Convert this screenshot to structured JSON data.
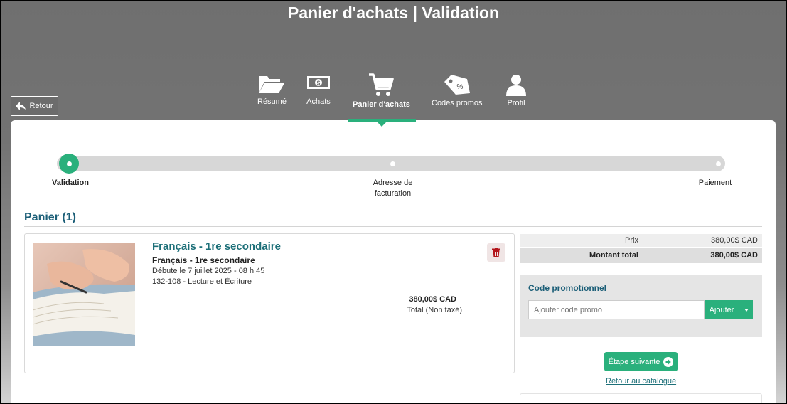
{
  "header": {
    "title": "Panier d'achats | Validation"
  },
  "back_button": {
    "label": "Retour"
  },
  "nav": {
    "items": [
      {
        "label": "Résumé",
        "icon": "folder-open-icon"
      },
      {
        "label": "Achats",
        "icon": "money-bill-icon"
      },
      {
        "label": "Panier d'achats",
        "icon": "shopping-cart-icon",
        "active": true
      },
      {
        "label": "Codes promos",
        "icon": "tag-percent-icon"
      },
      {
        "label": "Profil",
        "icon": "user-icon"
      }
    ]
  },
  "steps": [
    {
      "label": "Validation",
      "active": true
    },
    {
      "label_line1": "Adresse de",
      "label_line2": "facturation"
    },
    {
      "label": "Paiement"
    }
  ],
  "cart": {
    "heading": "Panier (1)",
    "item": {
      "title": "Français - 1re secondaire",
      "subtitle": "Français - 1re secondaire",
      "start": "Débute le 7 juillet 2025 - 08 h 45",
      "code": "132-108 - Lecture et Écriture",
      "price": "380,00$ CAD",
      "price_note": "Total (Non taxé)"
    }
  },
  "summary": {
    "price_label": "Prix",
    "price_value": "380,00$ CAD",
    "total_label": "Montant total",
    "total_value": "380,00$ CAD"
  },
  "promo": {
    "title": "Code promotionnel",
    "placeholder": "Ajouter code promo",
    "add_label": "Ajouter"
  },
  "actions": {
    "next_label": "Étape suivante",
    "catalog_link": "Retour au catalogue"
  },
  "colors": {
    "accent": "#2ab07c",
    "heading": "#1c5f78",
    "danger": "#b3151b"
  }
}
